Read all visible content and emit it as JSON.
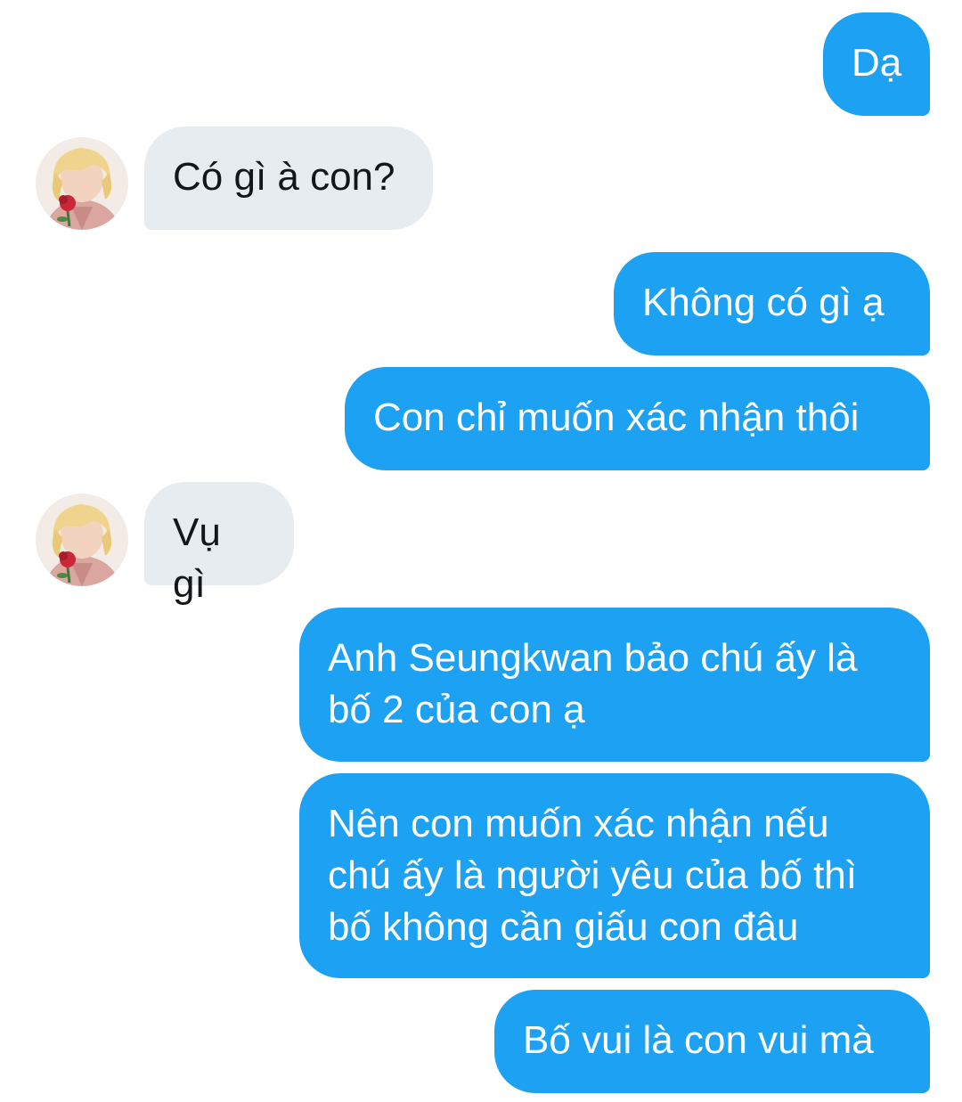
{
  "colors": {
    "outgoing_bubble": "#1DA1F2",
    "incoming_bubble": "#E6ECF0",
    "outgoing_text": "#FFFFFF",
    "incoming_text": "#14171A"
  },
  "messages": [
    {
      "sender": "me",
      "text": "Dạ"
    },
    {
      "sender": "other",
      "text": "Có gì à con?"
    },
    {
      "sender": "me",
      "text": "Không có gì ạ"
    },
    {
      "sender": "me",
      "text": "Con chỉ muốn xác nhận thôi"
    },
    {
      "sender": "other",
      "text": "Vụ gì"
    },
    {
      "sender": "me",
      "text": "Anh Seungkwan bảo chú ấy là\nbố 2 của con ạ"
    },
    {
      "sender": "me",
      "text": "Nên con muốn xác nhận nếu\nchú ấy là người yêu của bố thì\nbố không cần giấu con đâu"
    },
    {
      "sender": "me",
      "text": "Bố vui là con vui mà"
    }
  ]
}
